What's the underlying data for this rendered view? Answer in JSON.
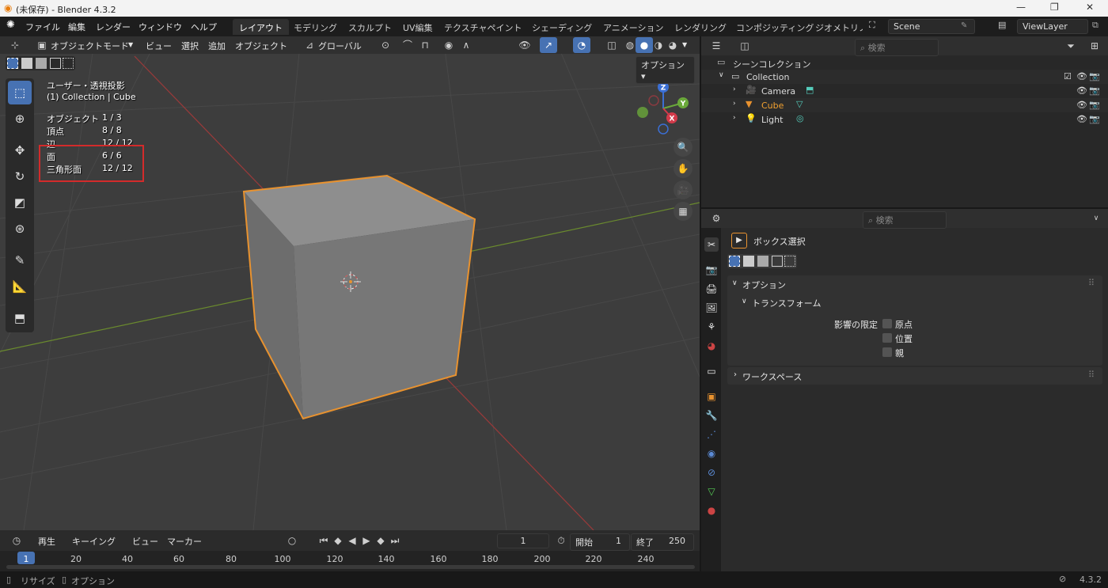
{
  "window": {
    "title": "(未保存) - Blender 4.3.2",
    "min": "—",
    "max": "❐",
    "close": "✕"
  },
  "menu": [
    "ファイル",
    "編集",
    "レンダー",
    "ウィンドウ",
    "ヘルプ"
  ],
  "workspaces": [
    {
      "label": "レイアウト",
      "active": true
    },
    {
      "label": "モデリング"
    },
    {
      "label": "スカルプト"
    },
    {
      "label": "UV編集"
    },
    {
      "label": "テクスチャペイント"
    },
    {
      "label": "シェーディング"
    },
    {
      "label": "アニメーション"
    },
    {
      "label": "レンダリング"
    },
    {
      "label": "コンポジッティング"
    },
    {
      "label": "ジオメトリノ"
    }
  ],
  "scene": "Scene",
  "view_layer": "ViewLayer",
  "viewport_header": {
    "mode": "オブジェクトモード",
    "menus": [
      "ビュー",
      "選択",
      "追加",
      "オブジェクト"
    ],
    "orientation": "グローバル",
    "options": "オプション"
  },
  "viewport_overlay": {
    "view_name": "ユーザー・透視投影",
    "collection_line": "(1) Collection | Cube",
    "stats": [
      {
        "label": "オブジェクト",
        "value": "1 / 3"
      },
      {
        "label": "頂点",
        "value": "8 / 8"
      },
      {
        "label": "辺",
        "value": "12 / 12"
      },
      {
        "label": "面",
        "value": "6 / 6"
      },
      {
        "label": "三角形面",
        "value": "12 / 12"
      }
    ]
  },
  "gizmo": {
    "z": "Z",
    "y": "Y",
    "x": "X"
  },
  "colors": {
    "accent": "#4772b3",
    "selection_outline": "#e8922f",
    "annotation_box": "#d32b2b",
    "axis_x": "#9b3a3a",
    "axis_y": "#6a8a2e"
  },
  "timeline": {
    "menus": [
      "再生",
      "キーイング",
      "ビュー",
      "マーカー"
    ],
    "current_frame": "1",
    "start_label": "開始",
    "start": "1",
    "end_label": "終了",
    "end": "250",
    "ruler": [
      "1",
      "20",
      "40",
      "60",
      "80",
      "100",
      "120",
      "140",
      "160",
      "180",
      "200",
      "220",
      "240"
    ]
  },
  "status_bar": {
    "left": [
      "リサイズ",
      "オプション"
    ],
    "version": "4.3.2"
  },
  "outliner": {
    "search_placeholder": "検索",
    "root": "シーンコレクション",
    "collection": "Collection",
    "items": [
      {
        "name": "Camera",
        "icon": "camera-icon",
        "color": "#dddddd"
      },
      {
        "name": "Cube",
        "icon": "mesh-icon",
        "color": "#f0a030"
      },
      {
        "name": "Light",
        "icon": "light-icon",
        "color": "#dddddd"
      }
    ]
  },
  "properties": {
    "search_placeholder": "検索",
    "tool_name": "ボックス選択",
    "options_panel": "オプション",
    "transform_panel": "トランスフォーム",
    "affect_only_label": "影響の限定",
    "checkboxes": [
      "原点",
      "位置",
      "親"
    ],
    "workspace_panel": "ワークスペース"
  }
}
